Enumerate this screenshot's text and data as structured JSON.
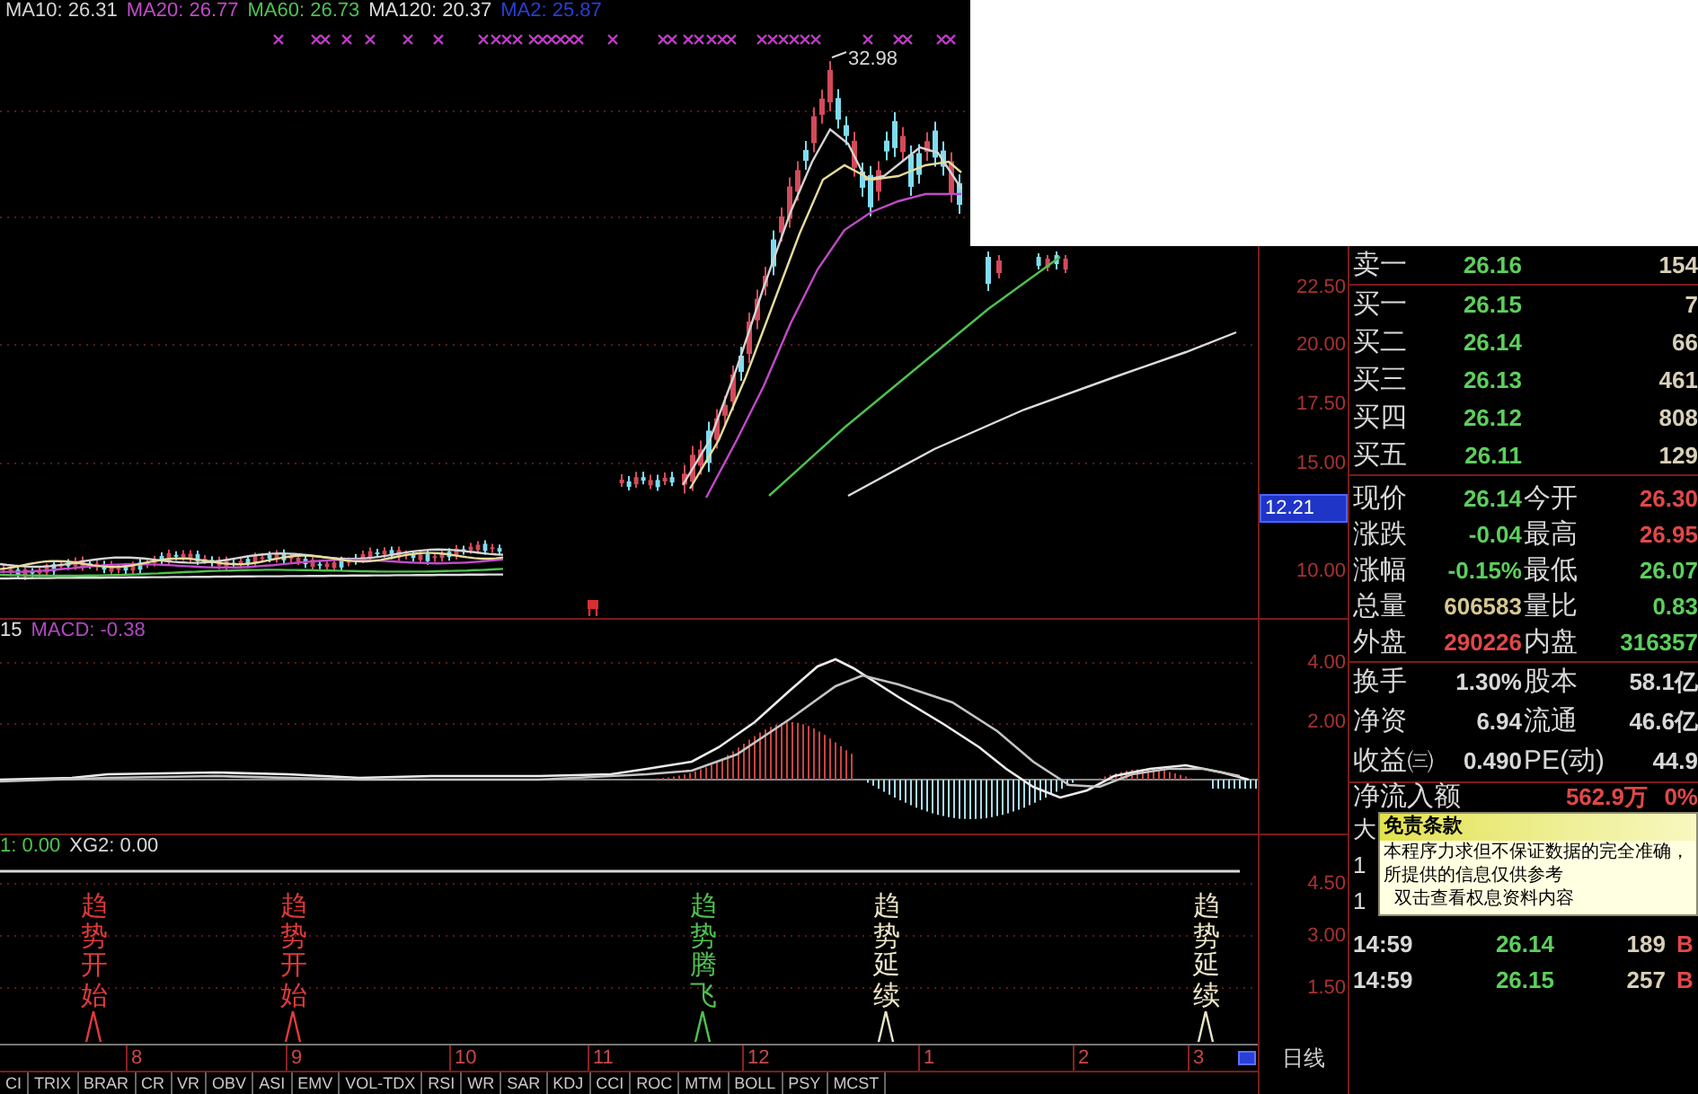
{
  "legend": [
    {
      "label": "MA10: 26.31",
      "color": "#d4d4d4"
    },
    {
      "label": "MA20: 26.77",
      "color": "#c24ac8"
    },
    {
      "label": "MA60: 26.73",
      "color": "#4fc24f"
    },
    {
      "label": "MA120: 20.37",
      "color": "#dcdcdc"
    },
    {
      "label": "MA2: 25.87",
      "color": "#2a3fd8"
    }
  ],
  "price_chart": {
    "peak_label": "32.98"
  },
  "price_axis": [
    {
      "text": "22.50",
      "highlighted": false
    },
    {
      "text": "20.00",
      "highlighted": false
    },
    {
      "text": "17.50",
      "highlighted": false
    },
    {
      "text": "15.00",
      "highlighted": false
    },
    {
      "text": "12.21",
      "highlighted": true
    },
    {
      "text": "10.00",
      "highlighted": false
    }
  ],
  "macd_panel": {
    "legend": [
      {
        "label": "15",
        "color": "#e0e0e0"
      },
      {
        "label": "MACD: -0.38",
        "color": "#b24ac0"
      }
    ],
    "axis": [
      "4.00",
      "2.00"
    ]
  },
  "signal_panel": {
    "legend": [
      {
        "label": "1: 0.00",
        "color": "#4fc24f"
      },
      {
        "label": "XG2: 0.00",
        "color": "#d8d8d8"
      }
    ],
    "axis": [
      "4.50",
      "3.00",
      "1.50"
    ],
    "signals": [
      {
        "text": "趋势开始",
        "color": "#e23a3a"
      },
      {
        "text": "趋势开始",
        "color": "#e23a3a"
      },
      {
        "text": "趋势腾飞",
        "color": "#4fc24f"
      },
      {
        "text": "趋势延续",
        "color": "#ece6c8"
      },
      {
        "text": "趋势延续",
        "color": "#ece6c8"
      }
    ]
  },
  "date_axis": [
    "8",
    "9",
    "10",
    "11",
    "12",
    "1",
    "2",
    "3"
  ],
  "period_label": "日线",
  "indicator_tabs": [
    "CI",
    "TRIX",
    "BRAR",
    "CR",
    "VR",
    "OBV",
    "ASI",
    "EMV",
    "VOL-TDX",
    "RSI",
    "WR",
    "SAR",
    "KDJ",
    "CCI",
    "ROC",
    "MTM",
    "BOLL",
    "PSY",
    "MCST"
  ],
  "quote_panel": {
    "sell": [
      {
        "label": "卖一",
        "price": "26.16",
        "volume": "154",
        "color": "#5ccf5c"
      }
    ],
    "buy": [
      {
        "label": "买一",
        "price": "26.15",
        "volume": "7",
        "color": "#5ccf5c"
      },
      {
        "label": "买二",
        "price": "26.14",
        "volume": "66",
        "color": "#5ccf5c"
      },
      {
        "label": "买三",
        "price": "26.13",
        "volume": "461",
        "color": "#5ccf5c"
      },
      {
        "label": "买四",
        "price": "26.12",
        "volume": "808",
        "color": "#5ccf5c"
      },
      {
        "label": "买五",
        "price": "26.11",
        "volume": "129",
        "color": "#5ccf5c"
      }
    ],
    "stats": [
      {
        "left": {
          "label": "现价",
          "value": "26.14",
          "color": "#5ccf5c"
        },
        "right": {
          "label": "今开",
          "value": "26.30",
          "color": "#e04848"
        }
      },
      {
        "left": {
          "label": "涨跌",
          "value": "-0.04",
          "color": "#5ccf5c"
        },
        "right": {
          "label": "最高",
          "value": "26.95",
          "color": "#e04848"
        }
      },
      {
        "left": {
          "label": "涨幅",
          "value": "-0.15%",
          "color": "#5ccf5c"
        },
        "right": {
          "label": "最低",
          "value": "26.07",
          "color": "#5ccf5c"
        }
      },
      {
        "left": {
          "label": "总量",
          "value": "606583",
          "color": "#d6c890"
        },
        "right": {
          "label": "量比",
          "value": "0.83",
          "color": "#5ccf5c"
        }
      },
      {
        "left": {
          "label": "外盘",
          "value": "290226",
          "color": "#e04848"
        },
        "right": {
          "label": "内盘",
          "value": "316357",
          "color": "#5ccf5c"
        }
      }
    ],
    "fundamentals": [
      {
        "left": {
          "label": "换手",
          "value": "1.30%"
        },
        "right": {
          "label": "股本",
          "value": "58.1亿"
        }
      },
      {
        "left": {
          "label": "净资",
          "value": "6.94"
        },
        "right": {
          "label": "流通",
          "value": "46.6亿"
        }
      },
      {
        "left": {
          "label": "收益㈢",
          "value": "0.490"
        },
        "right": {
          "label": "PE(动)",
          "value": "44.9"
        }
      }
    ],
    "net_inflow": {
      "label": "净流入额",
      "value": "562.9万",
      "share": "0%"
    },
    "covered_rows": [
      "大",
      "1",
      "1"
    ],
    "trades": [
      {
        "time": "14:59",
        "price": "26.14",
        "volume": "189",
        "side": "B",
        "color": "#5ccf5c"
      },
      {
        "time": "14:59",
        "price": "26.15",
        "volume": "257",
        "side": "B",
        "color": "#5ccf5c"
      }
    ]
  },
  "tooltip": {
    "title": "免责条款",
    "lines": [
      "本程序力求但不保证数据的完全准确，",
      "所提供的信息仅供参考",
      "双击查看权息资料内容"
    ]
  }
}
